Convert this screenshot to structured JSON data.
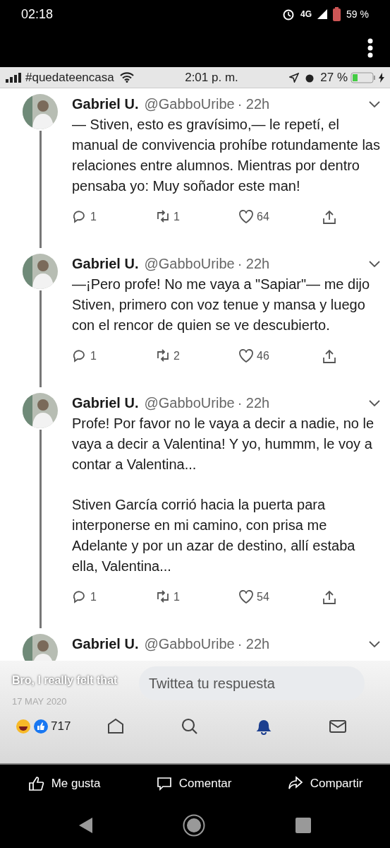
{
  "phone_status": {
    "time": "02:18",
    "network": "4G",
    "battery": "59 %"
  },
  "screenshot_status": {
    "carrier": "#quedateencasa",
    "time": "2:01 p. m.",
    "battery": "27 %"
  },
  "tweets": [
    {
      "name": "Gabriel U.",
      "handle": "@GabboUribe",
      "time": "· 22h",
      "paragraphs": [
        "— Stiven, esto es gravísimo,— le repetí, el manual de convivencia prohíbe rotundamente las relaciones entre alumnos. Mientras por dentro pensaba yo: Muy soñador este man!"
      ],
      "replies": "1",
      "retweets": "1",
      "likes": "64"
    },
    {
      "name": "Gabriel U.",
      "handle": "@GabboUribe",
      "time": "· 22h",
      "paragraphs": [
        "—¡Pero profe! No me vaya a \"Sapiar\"— me dijo Stiven, primero con voz tenue y mansa y luego con el rencor de quien se ve descubierto."
      ],
      "replies": "1",
      "retweets": "2",
      "likes": "46"
    },
    {
      "name": "Gabriel U.",
      "handle": "@GabboUribe",
      "time": "· 22h",
      "paragraphs": [
        "Profe! Por favor no le vaya a decir a nadie, no le vaya a decir a Valentina! Y yo, hummm, le voy a contar a Valentina...",
        "Stiven García corrió hacia la puerta para interponerse en mi camino, con prisa me Adelante y por un azar de destino, allí estaba ella, Valentina..."
      ],
      "replies": "1",
      "retweets": "1",
      "likes": "54"
    }
  ],
  "partial_tweet": {
    "name": "Gabriel U.",
    "handle": "@GabboUribe",
    "time": "· 22h"
  },
  "reply_field": {
    "placeholder": "Twittea tu respuesta"
  },
  "post_caption": "Bro, I really felt that",
  "post_date": "17 MAY 2020",
  "reaction_count": "717",
  "twitter_tabs": [
    {
      "kind": "home",
      "selected": false
    },
    {
      "kind": "search",
      "selected": false
    },
    {
      "kind": "notifications",
      "selected": true
    },
    {
      "kind": "messages",
      "selected": false
    }
  ],
  "post_actions": [
    {
      "kind": "like",
      "label": "Me gusta"
    },
    {
      "kind": "comment",
      "label": "Comentar"
    },
    {
      "kind": "share",
      "label": "Compartir"
    }
  ]
}
